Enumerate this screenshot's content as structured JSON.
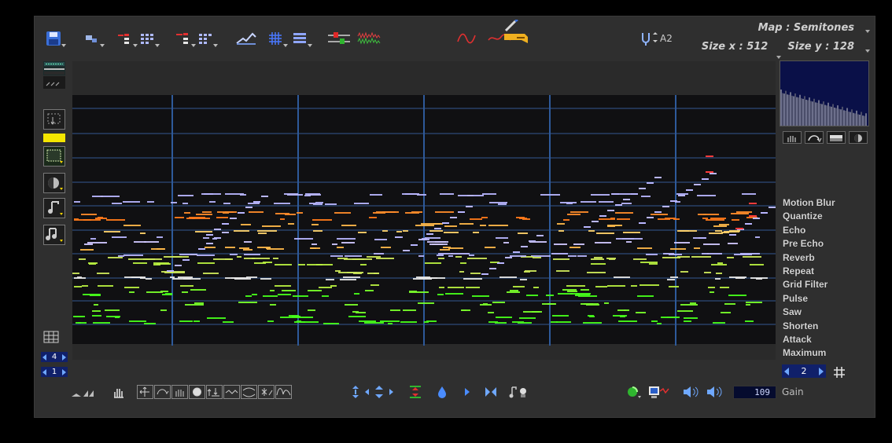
{
  "toolbar": {
    "icons": [
      "save-icon",
      "brush-tool-icon",
      "import-notes-icon",
      "import-grid-icon",
      "export-notes-icon",
      "export-grid-icon",
      "piano-roll-icon",
      "grid-view-icon",
      "layers-icon",
      "mixer-icon",
      "waveform-icon",
      "sine-wave-icon",
      "instrument-pen-icon"
    ],
    "pitch_value": "A2",
    "map_label": "Map : Semitones",
    "size_x_label": "Size x : 512",
    "size_y_label": "Size y : 128"
  },
  "left_panel": {
    "spin_top_value": "4",
    "spin_bottom_value": "1",
    "highlight_color": "#f5e600"
  },
  "effects": {
    "items": [
      "Motion Blur",
      "Quantize",
      "Echo",
      "Pre Echo",
      "Reverb",
      "Repeat",
      "Grid Filter",
      "Pulse",
      "Saw",
      "Shorten",
      "Attack",
      "Maximum"
    ],
    "selector_value": "2"
  },
  "bottom_bar": {
    "gain_value": "109",
    "gain_label": "Gain"
  },
  "colors": {
    "panel_bg": "#2f2f2f",
    "grid_bg": "#101012",
    "grid_line": "#2c4a78",
    "accent_blue": "#10206a"
  }
}
